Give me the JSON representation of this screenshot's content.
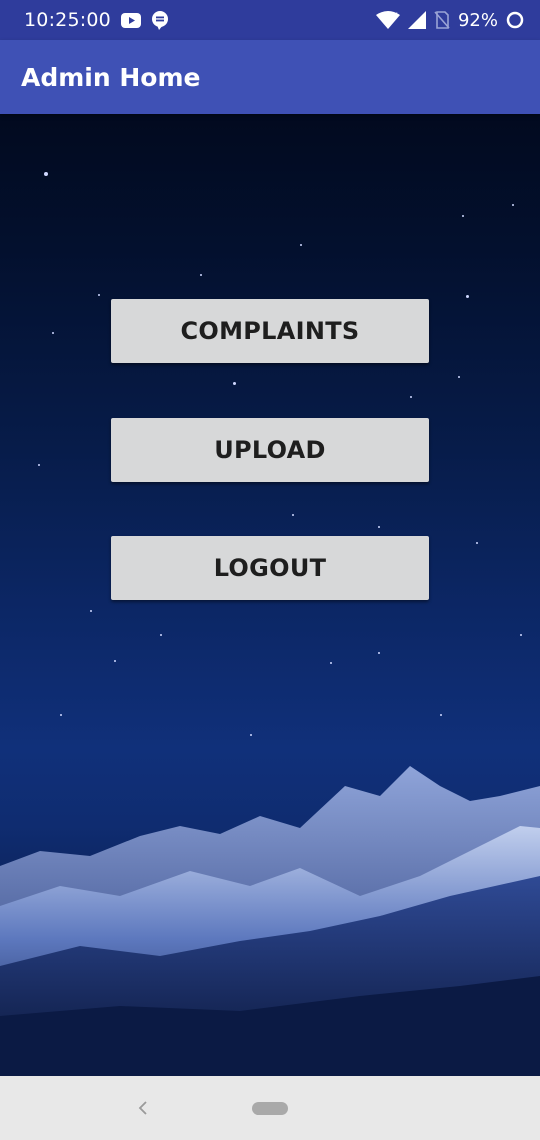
{
  "status_bar": {
    "time": "10:25:00",
    "battery": "92%",
    "icons": [
      "youtube-icon",
      "chat-bubble-icon",
      "wifi-icon",
      "signal-icon",
      "no-sim-icon",
      "battery-saver-icon"
    ]
  },
  "app_bar": {
    "title": "Admin Home",
    "color": "#3f51b5"
  },
  "buttons": {
    "complaints": "COMPLAINTS",
    "upload": "UPLOAD",
    "logout": "LOGOUT"
  },
  "nav_bar": {
    "icons": [
      "back-icon",
      "home-pill-icon"
    ]
  },
  "colors": {
    "status_bar": "#2f3c9c",
    "app_bar": "#3f51b5",
    "button_bg": "#d7d8d9",
    "button_text": "#1e1e1e",
    "nav_bar": "#e8e8e8"
  }
}
